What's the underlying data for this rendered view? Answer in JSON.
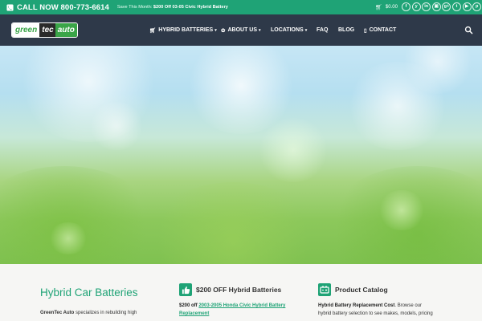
{
  "topbar": {
    "phone_label": "CALL NOW 800-773-6614",
    "promo_prefix": "Save This Month:",
    "promo_bold": "$200 Off 03-05 Civic Hybrid Battery",
    "cart_total": "$0.00",
    "social_icons": [
      "facebook-icon",
      "yelp-icon",
      "linkedin-icon",
      "instagram-icon",
      "google-plus-icon",
      "twitter-icon",
      "youtube-icon",
      "pinterest-icon"
    ]
  },
  "logo": {
    "part1": "green",
    "part2": "tec",
    "part3": "auto"
  },
  "nav": {
    "items": [
      {
        "label": "HYBRID BATTERIES",
        "icon": "cart-icon",
        "dropdown": true
      },
      {
        "label": "ABOUT US",
        "icon": "leaf-icon",
        "dropdown": true
      },
      {
        "label": "LOCATIONS",
        "icon": "",
        "dropdown": true
      },
      {
        "label": "FAQ",
        "icon": "",
        "dropdown": false
      },
      {
        "label": "BLOG",
        "icon": "",
        "dropdown": false
      },
      {
        "label": "CONTACT",
        "icon": "phone-icon",
        "dropdown": false
      }
    ]
  },
  "features": {
    "col1": {
      "title": "Hybrid Car Batteries",
      "brand": "GreenTec Auto",
      "text": " specializes in rebuilding high"
    },
    "col2": {
      "title": "$200 OFF Hybrid Batteries",
      "text_prefix": "$200 off ",
      "link": "2003-2005 Honda Civic Hybrid Battery",
      "link2": "Replacement"
    },
    "col3": {
      "title": "Product Catalog",
      "bold": "Hybrid Battery Replacement Cost",
      "text": ". Browse our",
      "line2": "hybrid battery selection to see makes, models, pricing"
    }
  },
  "colors": {
    "accent": "#1fa376",
    "navbar": "#2e3949",
    "logo_green": "#3aa548"
  }
}
